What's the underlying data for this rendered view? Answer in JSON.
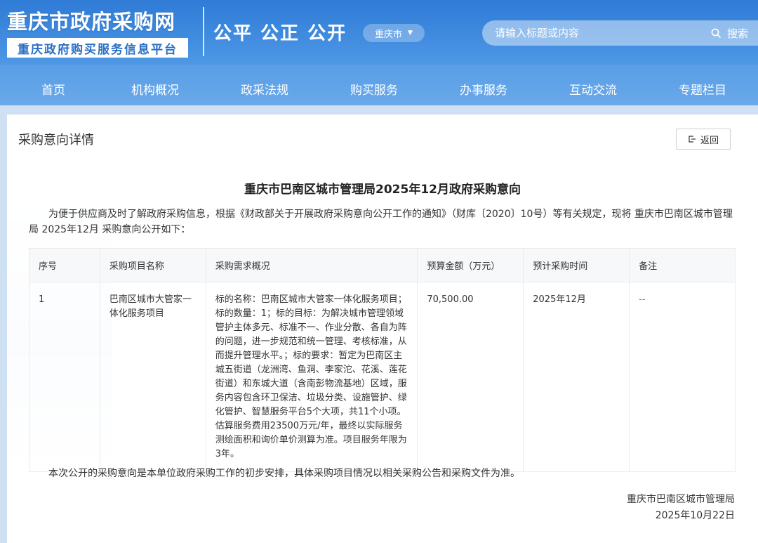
{
  "header": {
    "site_title": "重庆市政府采购网",
    "site_subtitle": "重庆政府购买服务信息平台",
    "slogan": "公平 公正 公开",
    "region": "重庆市",
    "search_placeholder": "请输入标题或内容",
    "search_label": "搜索"
  },
  "nav": {
    "items": [
      "首页",
      "机构概况",
      "政采法规",
      "购买服务",
      "办事服务",
      "互动交流",
      "专题栏目"
    ]
  },
  "panel": {
    "title": "采购意向详情",
    "back_label": "返回"
  },
  "document": {
    "title": "重庆市巴南区城市管理局2025年12月政府采购意向",
    "intro": "为便于供应商及时了解政府采购信息，根据《财政部关于开展政府采购意向公开工作的通知》（财库〔2020〕10号）等有关规定，现将 重庆市巴南区城市管理局 2025年12月 采购意向公开如下：",
    "table": {
      "headers": [
        "序号",
        "采购项目名称",
        "采购需求概况",
        "预算金额（万元）",
        "预计采购时间",
        "备注"
      ],
      "rows": [
        {
          "no": "1",
          "name": "巴南区城市大管家一体化服务项目",
          "summary": "标的名称：巴南区城市大管家一体化服务项目；标的数量：1；标的目标：为解决城市管理领域管护主体多元、标准不一、作业分散、各自为阵的问题，进一步规范和统一管理、考核标准，从而提升管理水平。；标的要求：暂定为巴南区主城五街道（龙洲湾、鱼洞、李家沱、花溪、莲花街道）和东城大道（含南彭物流基地）区域，服务内容包含环卫保洁、垃圾分类、设施管护、绿化管护、智慧服务平台5个大项，共11个小项。估算服务费用23500万元/年，最终以实际服务测绘面积和询价单价测算为准。项目服务年限为3年。",
          "budget": "70,500.00",
          "time": "2025年12月",
          "remark": "--"
        }
      ]
    },
    "footnote": "本次公开的采购意向是本单位政府采购工作的初步安排，具体采购项目情况以相关采购公告和采购文件为准。",
    "signature_org": "重庆市巴南区城市管理局",
    "signature_date": "2025年10月22日"
  }
}
